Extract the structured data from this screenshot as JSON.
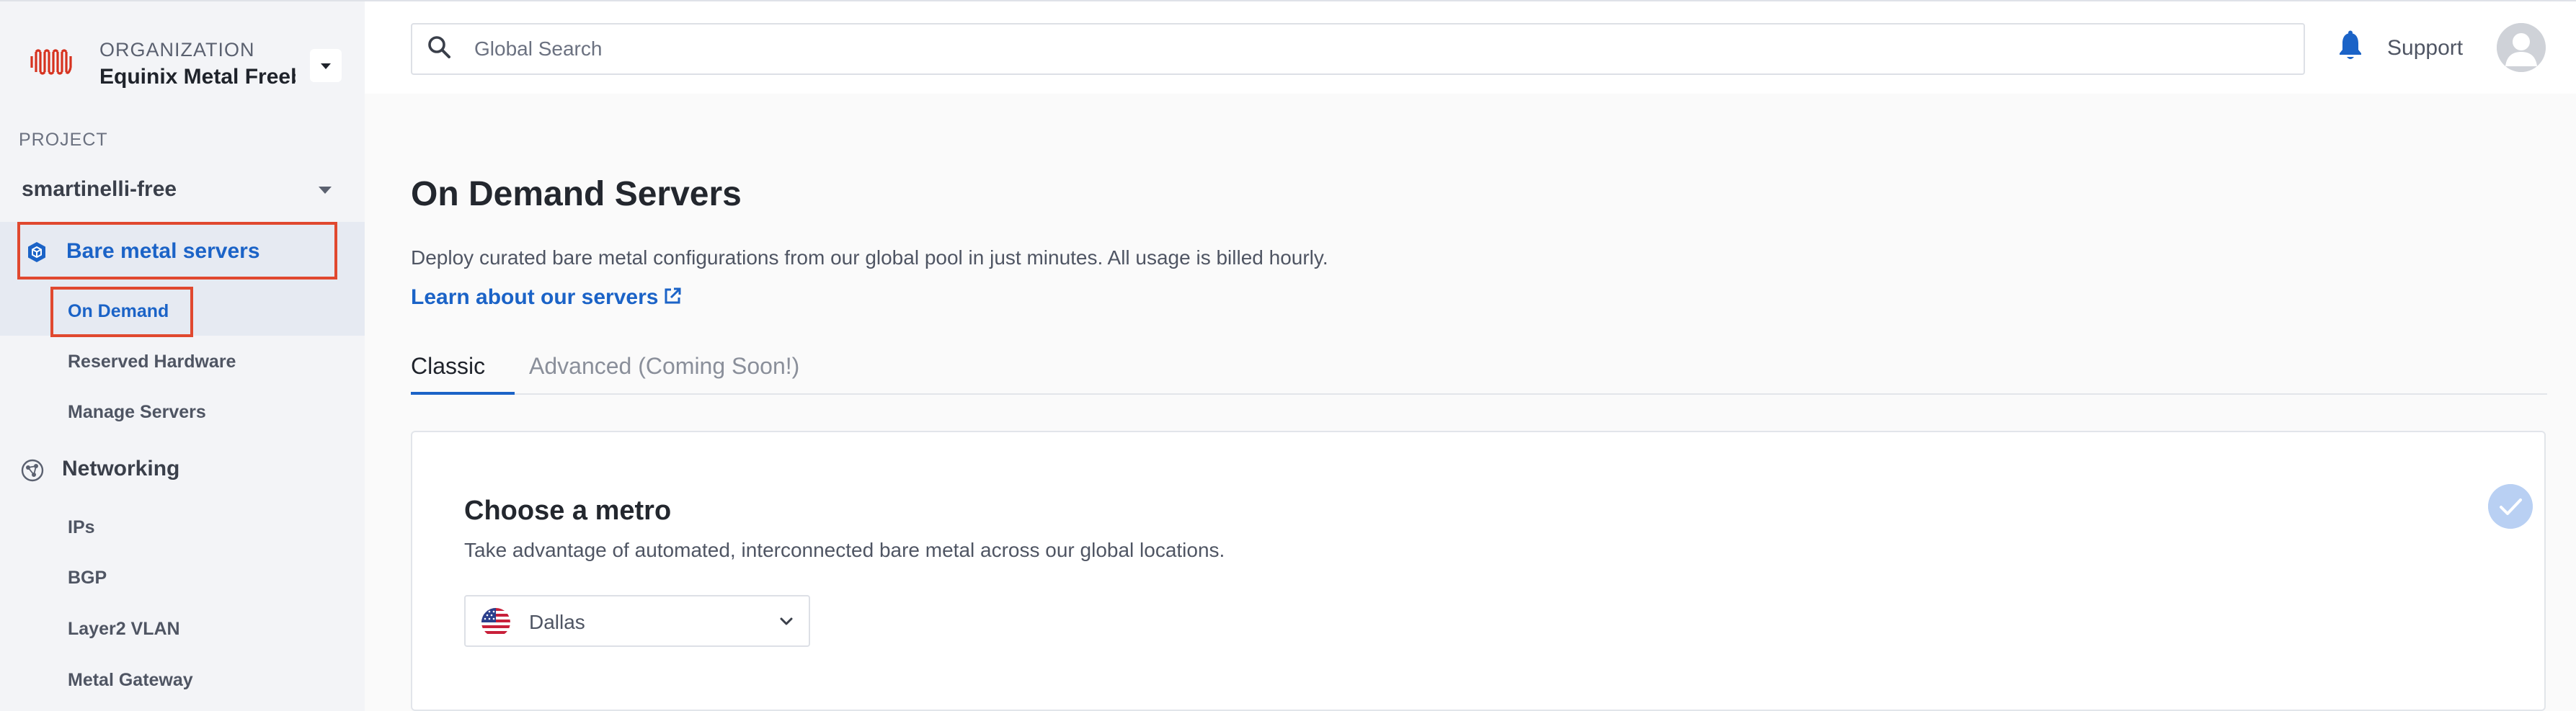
{
  "org": {
    "caption": "ORGANIZATION",
    "name": "Equinix Metal Freebie"
  },
  "project": {
    "caption": "PROJECT",
    "name": "smartinelli-free"
  },
  "sidebar": {
    "bare_metal": {
      "label": "Bare metal servers",
      "icon": "cube-icon"
    },
    "bare_metal_items": [
      "On Demand",
      "Reserved Hardware",
      "Manage Servers"
    ],
    "networking": {
      "label": "Networking",
      "icon": "globe-network-icon"
    },
    "networking_items": [
      "IPs",
      "BGP",
      "Layer2 VLAN",
      "Metal Gateway"
    ]
  },
  "topbar": {
    "search_placeholder": "Global Search",
    "support_label": "Support"
  },
  "main": {
    "title": "On Demand Servers",
    "description": "Deploy curated bare metal configurations from our global pool in just minutes. All usage is billed hourly.",
    "learn_link": "Learn about our servers",
    "tabs": [
      {
        "label": "Classic",
        "active": true
      },
      {
        "label": "Advanced (Coming Soon!)",
        "active": false
      }
    ],
    "metro_card": {
      "title": "Choose a metro",
      "description": "Take advantage of automated, interconnected bare metal across our global locations.",
      "selected_metro": "Dallas",
      "completed": true
    }
  },
  "colors": {
    "accent": "#1b63c7",
    "highlight_box": "#e0482f",
    "brand_logo": "#d6321f",
    "sidebar_bg": "#f3f4f7"
  }
}
